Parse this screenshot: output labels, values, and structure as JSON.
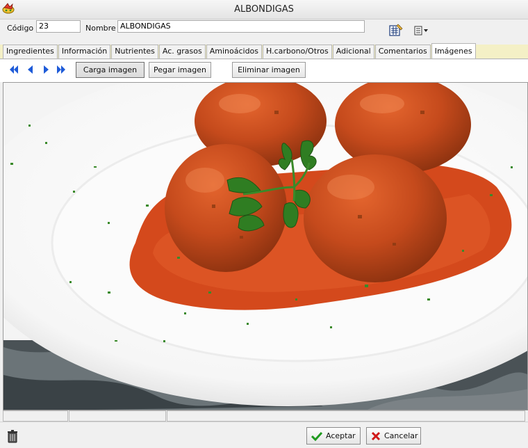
{
  "window": {
    "title": "ALBONDIGAS"
  },
  "fields": {
    "codigo_label": "Código",
    "codigo_value": "23",
    "nombre_label": "Nombre",
    "nombre_value": "ALBONDIGAS"
  },
  "tabs": [
    {
      "label": "Ingredientes"
    },
    {
      "label": "Información"
    },
    {
      "label": "Nutrientes"
    },
    {
      "label": "Ac. grasos"
    },
    {
      "label": "Aminoácidos"
    },
    {
      "label": "H.carbono/Otros"
    },
    {
      "label": "Adicional"
    },
    {
      "label": "Comentarios"
    },
    {
      "label": "Imágenes"
    }
  ],
  "active_tab": "Imágenes",
  "image_toolbar": {
    "load_label": "Carga imagen",
    "paste_label": "Pegar imagen",
    "delete_label": "Eliminar imagen"
  },
  "footer": {
    "accept_label": "Aceptar",
    "cancel_label": "Cancelar"
  },
  "colors": {
    "accent_nav": "#1e5bd8",
    "accept_check": "#1f9a1f",
    "cancel_x": "#d01818",
    "tab_strip": "#f4f0c6"
  }
}
